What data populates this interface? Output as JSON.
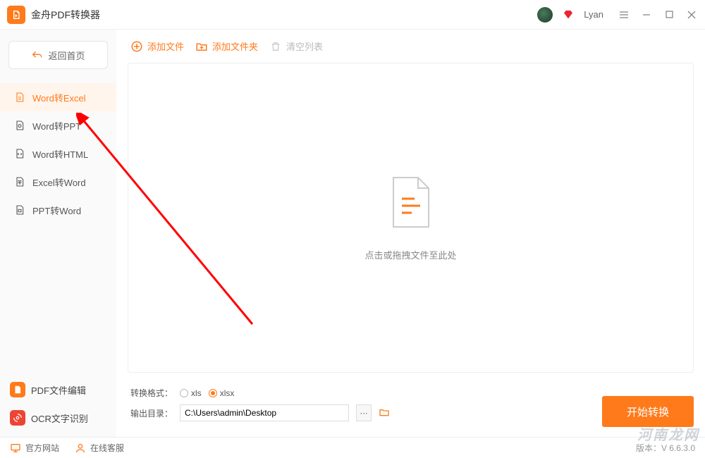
{
  "app": {
    "title": "金舟PDF转换器"
  },
  "user": {
    "name": "Lyan"
  },
  "sidebar": {
    "back_label": "返回首页",
    "items": [
      {
        "label": "Word转Excel"
      },
      {
        "label": "Word转PPT"
      },
      {
        "label": "Word转HTML"
      },
      {
        "label": "Excel转Word"
      },
      {
        "label": "PPT转Word"
      }
    ],
    "bottom": [
      {
        "label": "PDF文件编辑"
      },
      {
        "label": "OCR文字识别"
      }
    ]
  },
  "toolbar": {
    "add_file": "添加文件",
    "add_folder": "添加文件夹",
    "clear_list": "清空列表"
  },
  "dropzone": {
    "hint": "点击或拖拽文件至此处"
  },
  "options": {
    "format_label": "转换格式：",
    "xls": "xls",
    "xlsx": "xlsx",
    "output_label": "输出目录：",
    "output_path": "C:\\Users\\admin\\Desktop",
    "convert": "开始转换"
  },
  "footer": {
    "website": "官方网站",
    "support": "在线客服",
    "version": "版本：V 6.6.3.0"
  },
  "watermark": "河南龙网"
}
